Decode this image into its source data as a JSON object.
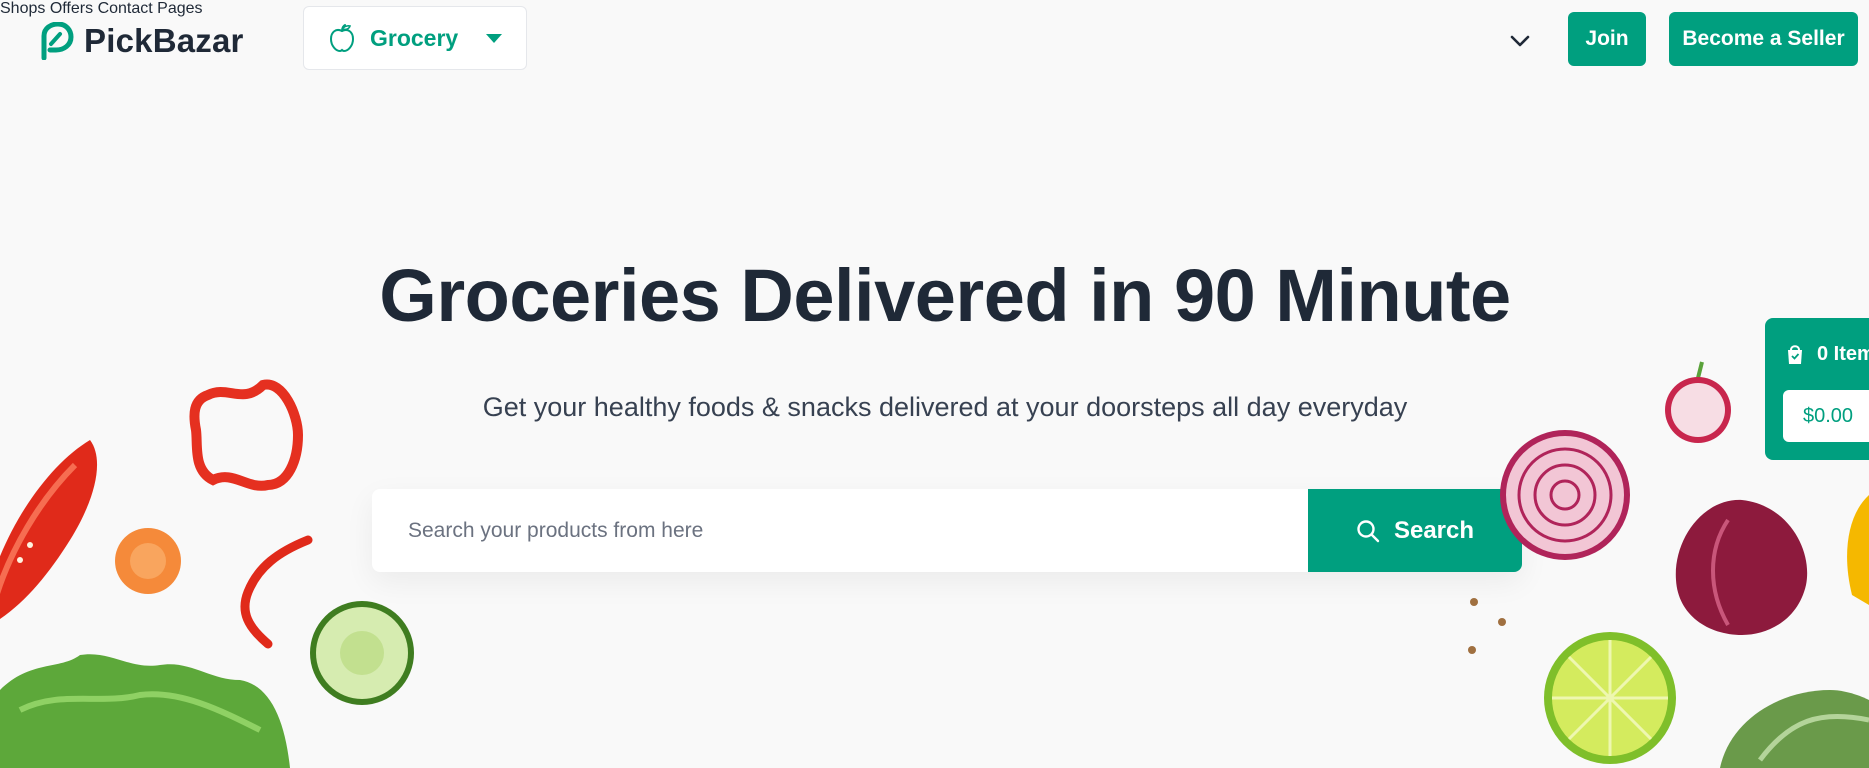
{
  "brand": {
    "name_part1": "Pick",
    "name_part2": "Bazar"
  },
  "type_selector": {
    "label": "Grocery",
    "icon": "apple-icon"
  },
  "nav": {
    "links": [
      {
        "label": "Shops"
      },
      {
        "label": "Offers"
      },
      {
        "label": "Contact"
      },
      {
        "label": "Pages"
      }
    ],
    "join_label": "Join",
    "seller_label": "Become a Seller"
  },
  "hero": {
    "title": "Groceries Delivered in 90 Minute",
    "subtitle": "Get your healthy foods & snacks delivered at your doorsteps all day everyday"
  },
  "search": {
    "placeholder": "Search your products from here",
    "button_label": "Search"
  },
  "cart": {
    "items_label": "0 Item",
    "total": "$0.00"
  },
  "colors": {
    "accent": "#009f7f",
    "heading": "#1f2937",
    "background": "#f9f9f9"
  }
}
